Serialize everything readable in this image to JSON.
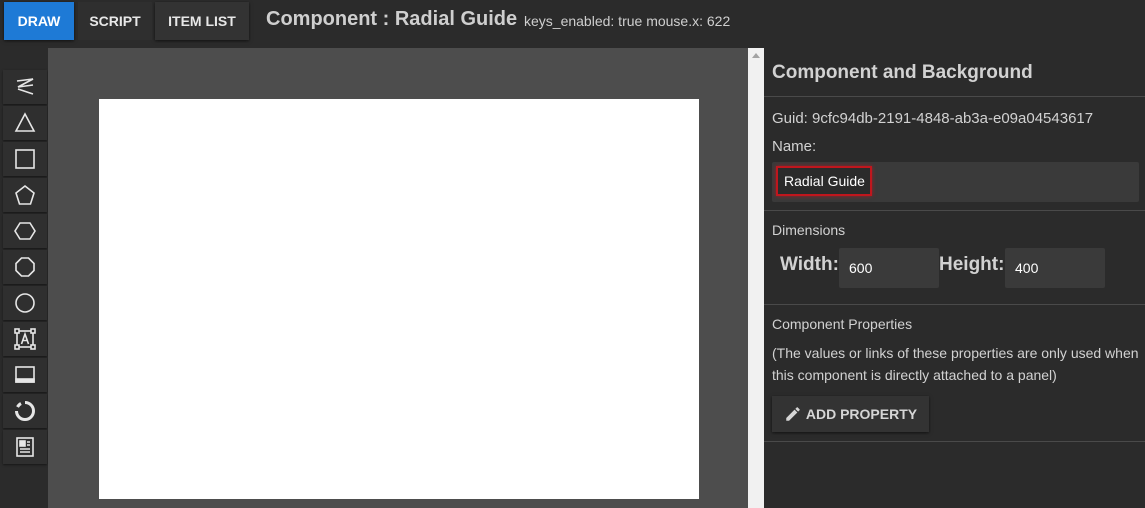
{
  "tabs": {
    "draw": "DRAW",
    "script": "SCRIPT",
    "item_list": "ITEM LIST"
  },
  "header": {
    "title": "Component : Radial Guide",
    "status": "keys_enabled: true mouse.x: 622"
  },
  "tools": [
    {
      "name": "pen-tool",
      "icon": "pen-icon"
    },
    {
      "name": "triangle-tool",
      "icon": "triangle-icon"
    },
    {
      "name": "rectangle-tool",
      "icon": "square-icon"
    },
    {
      "name": "pentagon-tool",
      "icon": "pentagon-icon"
    },
    {
      "name": "hexagon-tool",
      "icon": "hexagon-icon"
    },
    {
      "name": "octagon-tool",
      "icon": "octagon-icon"
    },
    {
      "name": "circle-tool",
      "icon": "circle-icon"
    },
    {
      "name": "text-tool",
      "icon": "text-box-icon"
    },
    {
      "name": "panel-tool",
      "icon": "panel-icon"
    },
    {
      "name": "radial-tool",
      "icon": "radial-icon"
    },
    {
      "name": "component-tool",
      "icon": "component-icon"
    }
  ],
  "panel": {
    "title": "Component and Background",
    "guid": "Guid: 9cfc94db-2191-4848-ab3a-e09a04543617",
    "name_label": "Name:",
    "name_value": "Radial Guide",
    "dimensions_label": "Dimensions",
    "width_label": "Width:",
    "width_value": "600",
    "height_label": "Height:",
    "height_value": "400",
    "props_label": "Component Properties",
    "props_note": "(The values or links of these properties are only used when this component is directly attached to a panel)",
    "add_property_label": "ADD PROPERTY"
  },
  "colors": {
    "accent": "#1e7ad6",
    "focus_border": "#c0161d",
    "background": "#2b2b2b",
    "canvas_bg": "#4d4d4d"
  }
}
